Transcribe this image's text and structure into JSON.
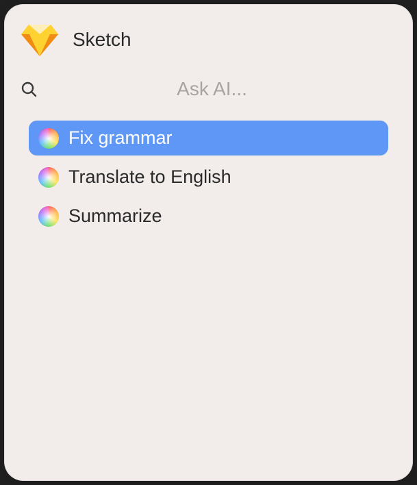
{
  "header": {
    "app_title": "Sketch"
  },
  "search": {
    "placeholder": "Ask AI...",
    "value": ""
  },
  "commands": [
    {
      "label": "Fix grammar",
      "selected": true
    },
    {
      "label": "Translate to English",
      "selected": false
    },
    {
      "label": "Summarize",
      "selected": false
    }
  ]
}
